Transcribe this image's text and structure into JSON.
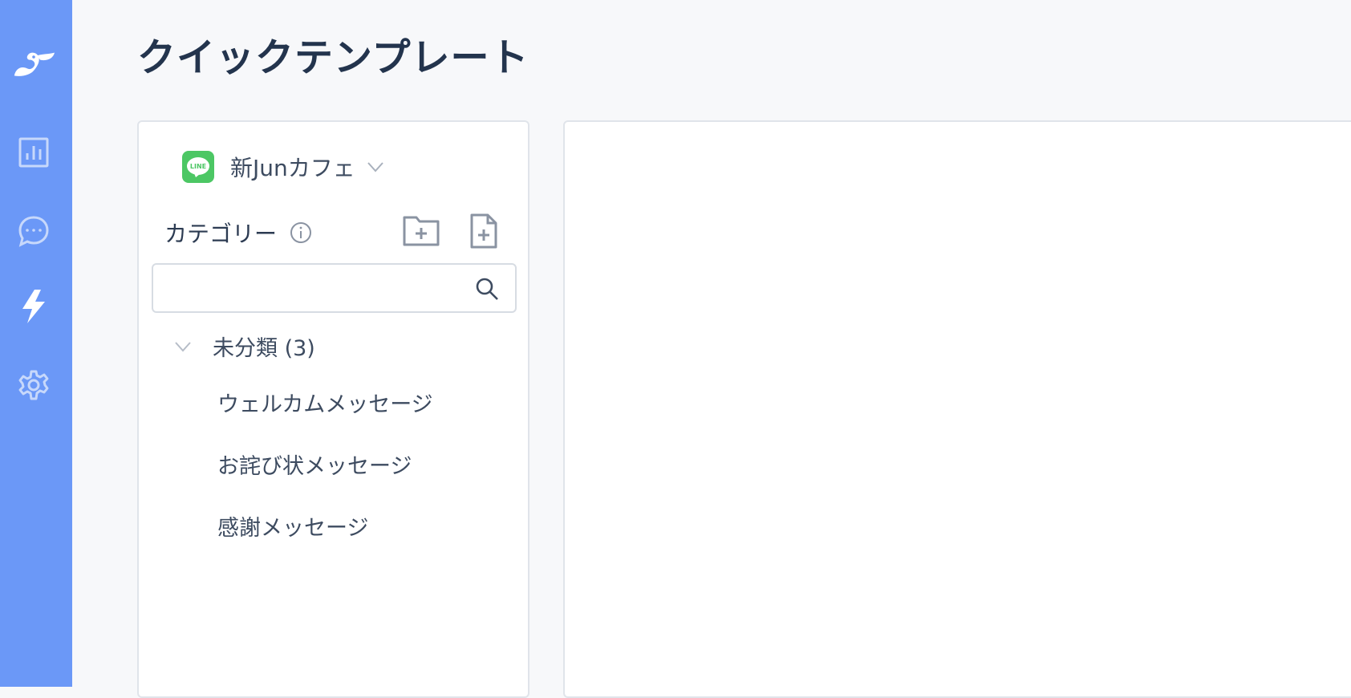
{
  "page": {
    "title": "クイックテンプレート"
  },
  "sidebar": {
    "items": [
      {
        "icon": "logo-icon"
      },
      {
        "icon": "chart-icon"
      },
      {
        "icon": "chat-icon"
      },
      {
        "icon": "lightning-icon"
      },
      {
        "icon": "gear-icon"
      }
    ]
  },
  "account": {
    "name": "新Junカフェ",
    "logo_text": "LINE"
  },
  "category": {
    "label": "カテゴリー"
  },
  "search": {
    "value": "",
    "placeholder": ""
  },
  "tree": {
    "group_label": "未分類 (3)",
    "items": [
      {
        "label": "ウェルカムメッセージ"
      },
      {
        "label": "お詫び状メッセージ"
      },
      {
        "label": "感謝メッセージ"
      }
    ]
  },
  "colors": {
    "sidebar": "#6b98f7",
    "line_green": "#4cc764",
    "background": "#f7f8fa"
  }
}
